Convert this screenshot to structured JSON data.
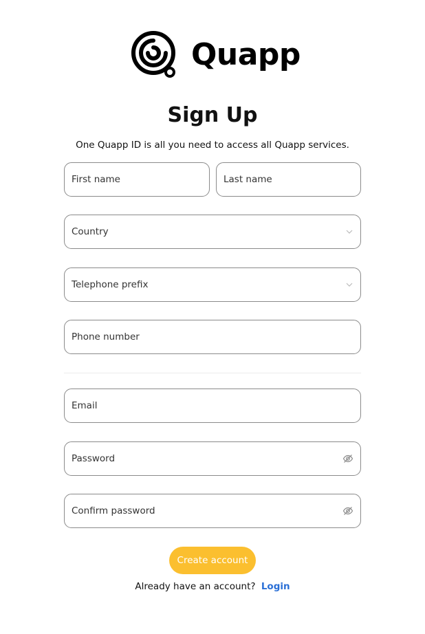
{
  "brand": {
    "name": "Quapp"
  },
  "heading": {
    "title": "Sign Up",
    "subtitle": "One Quapp ID is all you need to access all Quapp services."
  },
  "form": {
    "first_name": {
      "label": "First name"
    },
    "last_name": {
      "label": "Last name"
    },
    "country": {
      "label": "Country",
      "icon": "chevron-down-icon"
    },
    "telephone_prefix": {
      "label": "Telephone prefix",
      "icon": "chevron-down-icon"
    },
    "phone_number": {
      "label": "Phone number"
    },
    "email": {
      "label": "Email"
    },
    "password": {
      "label": "Password",
      "icon": "eye-off-icon"
    },
    "confirm_password": {
      "label": "Confirm password",
      "icon": "eye-off-icon"
    },
    "submit_label": "Create account"
  },
  "footer": {
    "prompt": "Already have an account?",
    "login_label": "Login"
  },
  "colors": {
    "accent": "#fbbf2f",
    "link": "#2a6fd6",
    "field_border": "#8a8a8a"
  }
}
